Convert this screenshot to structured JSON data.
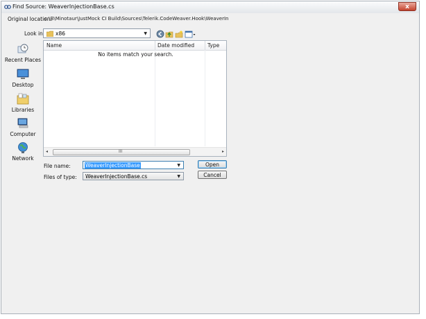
{
  "window": {
    "title": "Find Source: WeaverInjectionBase.cs",
    "close_glyph": "x"
  },
  "original_location": {
    "label": "Original location:",
    "path": "c:\\B\\Minotaur\\JustMock CI Build\\Sources\\Telerik.CodeWeaver.Hook\\WeaverInjectionBase.cs"
  },
  "look_in": {
    "label": "Look in:",
    "value": "x86",
    "arrow": "▼"
  },
  "toolbar": {
    "icons": [
      "back-icon",
      "up-folder-icon",
      "new-folder-icon",
      "view-menu-icon"
    ]
  },
  "places": [
    {
      "label": "Recent Places",
      "icon": "recent-places-icon"
    },
    {
      "label": "Desktop",
      "icon": "desktop-icon"
    },
    {
      "label": "Libraries",
      "icon": "libraries-icon"
    },
    {
      "label": "Computer",
      "icon": "computer-icon"
    },
    {
      "label": "Network",
      "icon": "network-icon"
    }
  ],
  "file_list": {
    "columns": [
      "Name",
      "Date modified",
      "Type"
    ],
    "sort_glyph": "^",
    "empty_message": "No items match your search.",
    "scroll_left": "◂",
    "scroll_right": "▸",
    "scroll_grip": "III"
  },
  "file_name": {
    "label": "File name:",
    "value": "WeaverInjectionBase",
    "arrow": "▼"
  },
  "file_type": {
    "label": "Files of type:",
    "value": "WeaverInjectionBase.cs",
    "arrow": "▼"
  },
  "buttons": {
    "open": "Open",
    "cancel": "Cancel"
  }
}
